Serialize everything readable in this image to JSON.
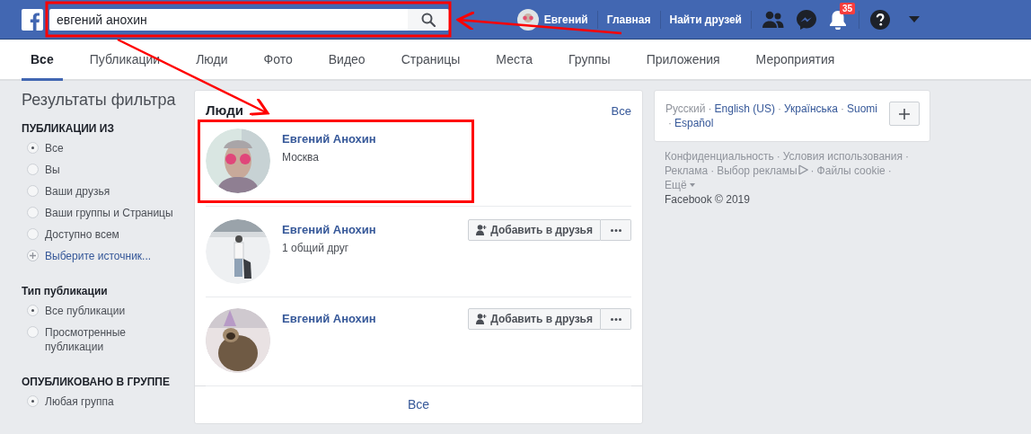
{
  "top_bar": {
    "search": {
      "value": "евгений анохин"
    },
    "user": {
      "name": "Евгений"
    },
    "nav_links": [
      "Главная",
      "Найти друзей"
    ],
    "notifications": {
      "count": "35"
    }
  },
  "tabs": [
    {
      "label": "Все",
      "selected": true
    },
    {
      "label": "Публикации",
      "selected": false
    },
    {
      "label": "Люди",
      "selected": false
    },
    {
      "label": "Фото",
      "selected": false
    },
    {
      "label": "Видео",
      "selected": false
    },
    {
      "label": "Страницы",
      "selected": false
    },
    {
      "label": "Места",
      "selected": false
    },
    {
      "label": "Группы",
      "selected": false
    },
    {
      "label": "Приложения",
      "selected": false
    },
    {
      "label": "Мероприятия",
      "selected": false
    }
  ],
  "sidebar": {
    "title": "Результаты фильтра",
    "sections": [
      {
        "heading": "ПУБЛИКАЦИИ ИЗ",
        "items": [
          {
            "kind": "radio",
            "label": "Все",
            "selected": true
          },
          {
            "kind": "radio",
            "label": "Вы",
            "selected": false
          },
          {
            "kind": "radio",
            "label": "Ваши друзья",
            "selected": false
          },
          {
            "kind": "radio",
            "label": "Ваши группы и Страницы",
            "selected": false
          },
          {
            "kind": "radio",
            "label": "Доступно всем",
            "selected": false
          },
          {
            "kind": "add",
            "label": "Выберите источник..."
          }
        ]
      },
      {
        "heading": "Тип публикации",
        "items": [
          {
            "kind": "radio",
            "label": "Все публикации",
            "selected": true
          },
          {
            "kind": "radio",
            "label": "Просмотренные публикации",
            "selected": false
          }
        ]
      },
      {
        "heading": "ОПУБЛИКОВАНО В ГРУППЕ",
        "items": [
          {
            "kind": "radio",
            "label": "Любая группа",
            "selected": true
          }
        ]
      }
    ]
  },
  "people": {
    "title": "Люди",
    "see_all_top": "Все",
    "results": [
      {
        "name": "Евгений Анохин",
        "detail": "Москва",
        "highlighted": true
      },
      {
        "name": "Евгений Анохин",
        "detail": "1 общий друг",
        "add_button": "Добавить в друзья",
        "highlighted": false
      },
      {
        "name": "Евгений Анохин",
        "add_button": "Добавить в друзья",
        "highlighted": false
      }
    ],
    "see_all_bottom": "Все"
  },
  "languages": [
    {
      "label": "Русский",
      "selected": true
    },
    {
      "separator": "·",
      "label": "English (US)",
      "selected": false
    },
    {
      "separator": "·",
      "label": "Українська",
      "selected": false
    },
    {
      "separator": "·",
      "label": "Suomi",
      "selected": false
    },
    {
      "separator": "·",
      "label": "Español",
      "selected": false
    }
  ],
  "footer_links": [
    {
      "label": "Конфиденциальность",
      "separator": "·"
    },
    {
      "label": "Условия использования",
      "separator": "·"
    },
    {
      "label": "Реклама",
      "separator": "·"
    },
    {
      "label": "Выбор рекламы",
      "separator": "·"
    },
    {
      "label": "Файлы cookie",
      "separator": "·"
    },
    {
      "label": "Ещё"
    }
  ],
  "copyright": "Facebook © 2019"
}
